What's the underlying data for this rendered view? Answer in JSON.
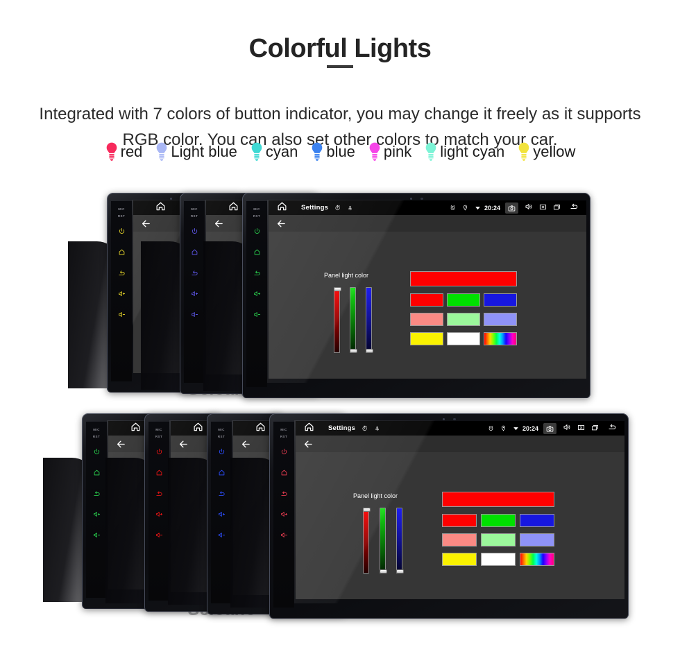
{
  "header": {
    "title": "Colorful Lights",
    "subtitle": "Integrated with 7 colors of button indicator, you may change it freely as it supports RGB color. You can also set other colors to match your car."
  },
  "legend": {
    "items": [
      {
        "label": "red",
        "color": "#f72a5c"
      },
      {
        "label": "Light blue",
        "color": "#a9b7f5"
      },
      {
        "label": "cyan",
        "color": "#3fd9d4"
      },
      {
        "label": "blue",
        "color": "#3b82f0"
      },
      {
        "label": "pink",
        "color": "#f645e8"
      },
      {
        "label": "light cyan",
        "color": "#7cf3d6"
      },
      {
        "label": "yellow",
        "color": "#f2e33c"
      }
    ]
  },
  "device_ui": {
    "statusbar": {
      "home_icon": "home-icon",
      "title": "Settings",
      "stopwatch_icon": "stopwatch-icon",
      "usb_icon": "usb-icon",
      "alarm_icon": "alarm-icon",
      "location_icon": "location-pin-icon",
      "signal_icon": "signal-triangle-icon",
      "time": "20:24",
      "camera_icon": "camera-icon",
      "volume_icon": "speaker-icon",
      "close_icon": "close-box-icon",
      "recents_icon": "recent-apps-icon",
      "back_icon": "back-arrow-icon"
    },
    "actionbar": {
      "back_icon": "back-arrow-icon"
    },
    "panel": {
      "label": "Panel light color",
      "sliders": [
        {
          "name": "red",
          "value": 100,
          "track_top": "#ff0000",
          "track_bottom": "#240000"
        },
        {
          "name": "green",
          "value": 0,
          "track_top": "#16e016",
          "track_bottom": "#012101"
        },
        {
          "name": "blue",
          "value": 0,
          "track_top": "#1e1ef0",
          "track_bottom": "#030326"
        }
      ],
      "preview_color": "#ff0000",
      "swatches": [
        {
          "name": "red",
          "color": "#ff0000"
        },
        {
          "name": "green",
          "color": "#00e000"
        },
        {
          "name": "blue",
          "color": "#1717e0"
        },
        {
          "name": "salmon",
          "color": "#fa8a84"
        },
        {
          "name": "light-green",
          "color": "#9bf79b"
        },
        {
          "name": "periwinkle",
          "color": "#8f93f7"
        },
        {
          "name": "yellow",
          "color": "#faf200"
        },
        {
          "name": "white",
          "color": "#ffffff"
        },
        {
          "name": "rainbow",
          "color": "rainbow"
        }
      ]
    },
    "side_buttons": {
      "mic_label": "MIC",
      "rst_label": "RST",
      "keys": [
        "power-icon",
        "home-icon",
        "back-icon",
        "volume-up-icon",
        "volume-down-icon"
      ]
    }
  },
  "groups": [
    {
      "name": "device-group-top",
      "watermark": "Seicane",
      "devices": [
        {
          "key_color": "#d8c827",
          "key_color_name": "yellow",
          "active": false
        },
        {
          "key_color": "#5a53e0",
          "key_color_name": "blue-violet",
          "active": false
        },
        {
          "key_color": "#27c64a",
          "key_color_name": "green",
          "active": true
        }
      ]
    },
    {
      "name": "device-group-bottom",
      "watermark": "Seicane",
      "devices": [
        {
          "key_color": "#27c64a",
          "key_color_name": "green",
          "active": false
        },
        {
          "key_color": "#e01414",
          "key_color_name": "red",
          "active": false
        },
        {
          "key_color": "#2a4af0",
          "key_color_name": "blue",
          "active": false
        },
        {
          "key_color": "#e03a4e",
          "key_color_name": "pink",
          "active": true
        }
      ]
    }
  ]
}
